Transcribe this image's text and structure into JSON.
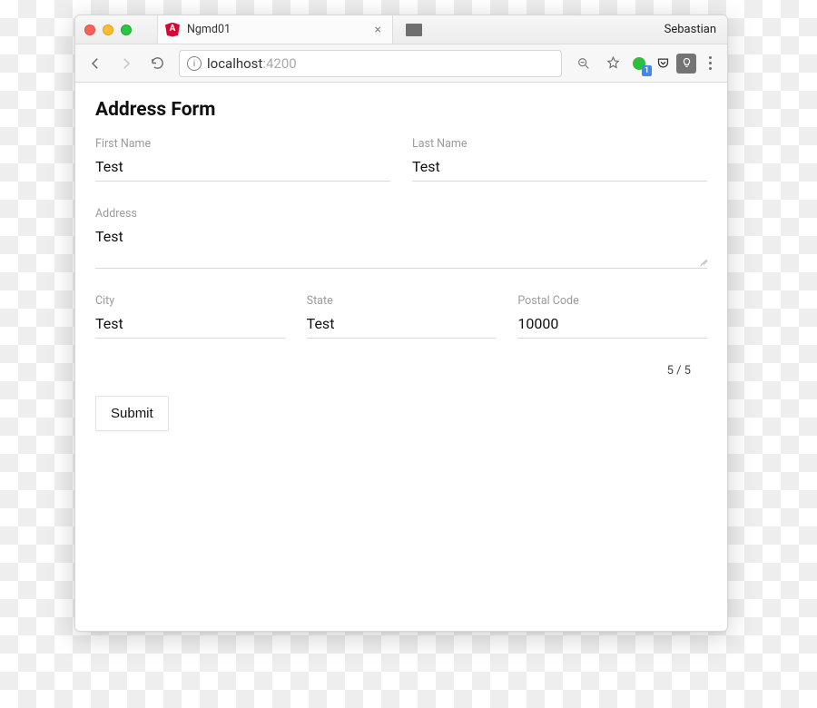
{
  "window": {
    "profile": "Sebastian",
    "tab_title": "Ngmd01",
    "favicon_letter": "A"
  },
  "toolbar": {
    "url_host": "localhost",
    "url_port": ":4200",
    "ext_badge": "1"
  },
  "page": {
    "title": "Address Form",
    "labels": {
      "first_name": "First Name",
      "last_name": "Last Name",
      "address": "Address",
      "city": "City",
      "state": "State",
      "postal_code": "Postal Code"
    },
    "values": {
      "first_name": "Test",
      "last_name": "Test",
      "address": "Test",
      "city": "Test",
      "state": "Test",
      "postal_code": "10000"
    },
    "counter": "5 / 5",
    "submit": "Submit"
  }
}
